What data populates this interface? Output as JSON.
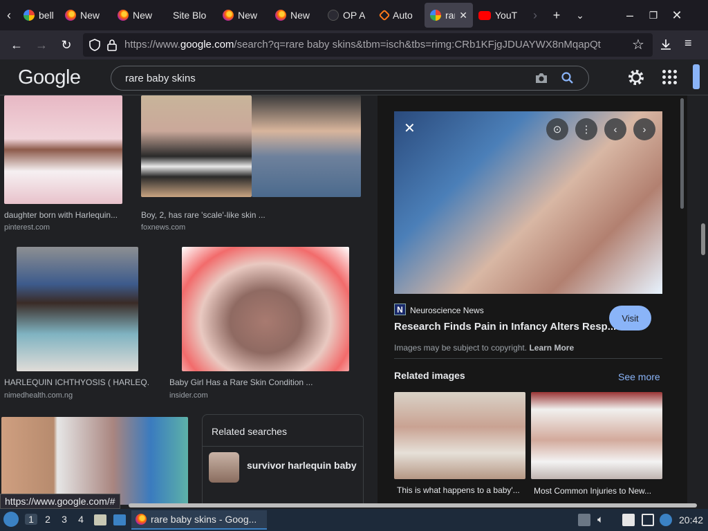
{
  "browser": {
    "tabs": [
      {
        "label": "belle",
        "favicon": "google-icon"
      },
      {
        "label": "New",
        "favicon": "firefox-icon"
      },
      {
        "label": "New",
        "favicon": "firefox-icon"
      },
      {
        "label": "Site Blo",
        "favicon": "none"
      },
      {
        "label": "New",
        "favicon": "firefox-icon"
      },
      {
        "label": "New",
        "favicon": "firefox-icon"
      },
      {
        "label": "OP A",
        "favicon": "openai-icon"
      },
      {
        "label": "Auto",
        "favicon": "automation-icon"
      },
      {
        "label": "rar",
        "favicon": "google-icon",
        "active": true
      },
      {
        "label": "YouT",
        "favicon": "youtube-icon"
      }
    ],
    "url_prefix": "https://www.",
    "url_domain": "google.com",
    "url_rest": "/search?q=rare baby skins&tbm=isch&tbs=rimg:CRb1KFjgJDUAYWX8nMqapQt"
  },
  "google": {
    "logo": "Google",
    "query": "rare baby skins"
  },
  "results": [
    {
      "caption": "daughter born with Harlequin...",
      "source": "pinterest.com"
    },
    {
      "caption": "Boy, 2, has rare 'scale'-like skin ...",
      "source": "foxnews.com"
    },
    {
      "caption": "HARLEQUIN ICHTHYOSIS ( HARLEQ...",
      "source": "nimedhealth.com.ng"
    },
    {
      "caption": "Baby Girl Has a Rare Skin Condition ...",
      "source": "insider.com"
    }
  ],
  "related_searches": {
    "title": "Related searches",
    "items": [
      {
        "label": "survivor harlequin baby"
      }
    ]
  },
  "panel": {
    "source_name": "Neuroscience News",
    "source_icon_letter": "N",
    "title": "Research Finds Pain in Infancy Alters Resp...",
    "visit_label": "Visit",
    "copyright_text": "Images may be subject to copyright.",
    "learn_more": "Learn More",
    "related_images_title": "Related images",
    "see_more": "See more",
    "related": [
      {
        "caption": "This is what happens to a baby'..."
      },
      {
        "caption": "Most Common Injuries to New..."
      }
    ]
  },
  "status_url": "https://www.google.com/#",
  "taskbar": {
    "workspaces": [
      "1",
      "2",
      "3",
      "4"
    ],
    "active_window": "rare baby skins - Goog...",
    "clock": "20:42"
  }
}
